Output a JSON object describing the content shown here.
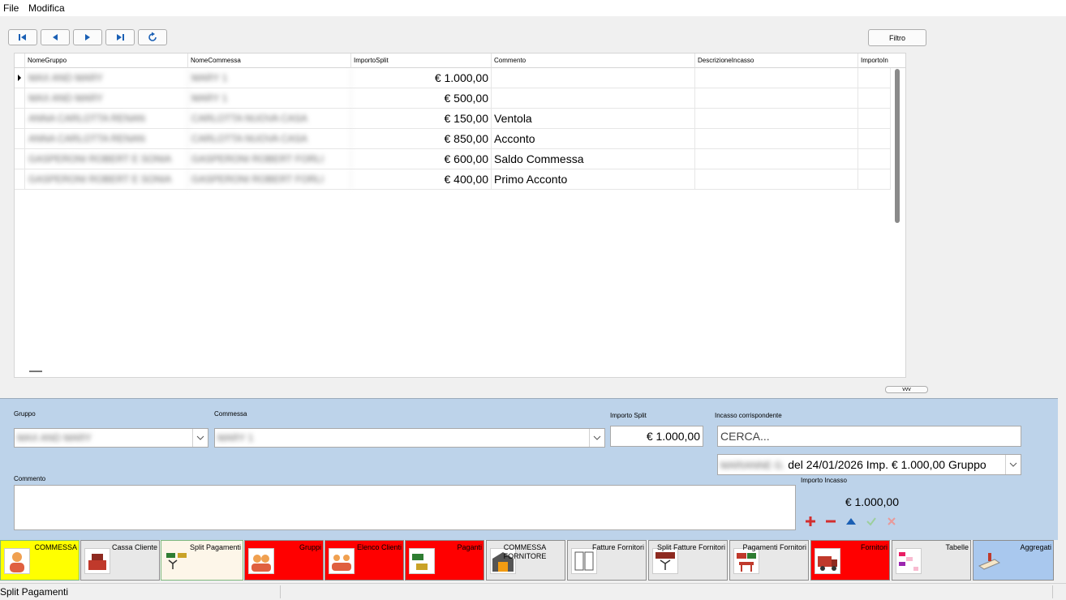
{
  "menu": {
    "file": "File",
    "edit": "Modifica"
  },
  "toolbar": {
    "first_icon": "first-record-icon",
    "prev_icon": "previous-record-icon",
    "next_icon": "next-record-icon",
    "last_icon": "last-record-icon",
    "refresh_icon": "refresh-icon",
    "filter_label": "Filtro"
  },
  "grid": {
    "columns": [
      "NomeGruppo",
      "NomeCommessa",
      "ImportoSplit",
      "Commento",
      "DescrizioneIncasso",
      "ImportoIn"
    ],
    "rows": [
      {
        "gruppo": "MAX AND MARY",
        "commessa": "MARY 1",
        "importo": "€ 1.000,00",
        "commento": ""
      },
      {
        "gruppo": "MAX AND MARY",
        "commessa": "MARY 1",
        "importo": "€ 500,00",
        "commento": ""
      },
      {
        "gruppo": "ANNA CARLOTTA RENAN",
        "commessa": "CARLOTTA NUOVA CASA",
        "importo": "€ 150,00",
        "commento": "Ventola"
      },
      {
        "gruppo": "ANNA CARLOTTA RENAN",
        "commessa": "CARLOTTA NUOVA CASA",
        "importo": "€ 850,00",
        "commento": "Acconto"
      },
      {
        "gruppo": "GASPERONI ROBERT E SONIA",
        "commessa": "GASPERONI ROBERT FORLI",
        "importo": "€ 600,00",
        "commento": "Saldo Commessa"
      },
      {
        "gruppo": "GASPERONI ROBERT E SONIA",
        "commessa": "GASPERONI ROBERT FORLI",
        "importo": "€ 400,00",
        "commento": "Primo Acconto"
      }
    ],
    "current_row_icon": "current-row-indicator-icon",
    "small_button": "vvv"
  },
  "form": {
    "gruppo_label": "Gruppo",
    "gruppo_value": "MAX AND MARY",
    "commessa_label": "Commessa",
    "commessa_value": "MARY 1",
    "importo_split_label": "Importo Split",
    "importo_split_value": "€ 1.000,00",
    "incasso_label": "Incasso corrispondente",
    "cerca_placeholder": "CERCA...",
    "incasso_name": "MARIANNE G.",
    "incasso_value": "del 24/01/2026 Imp. € 1.000,00 Gruppo",
    "commento_label": "Commento",
    "commento_value": "",
    "importo_incasso_label": "Importo Incasso",
    "importo_incasso_value": "€ 1.000,00",
    "actions": {
      "add_icon": "plus-icon",
      "remove_icon": "minus-icon",
      "up_icon": "triangle-up-icon",
      "confirm_icon": "check-icon",
      "cancel_icon": "x-icon"
    }
  },
  "tabs": [
    {
      "label": "COMMESSA",
      "bg": "#ffff00",
      "icon": "person-icon"
    },
    {
      "label": "Cassa Cliente",
      "bg": "#e8e8e8",
      "icon": "cash-register-icon"
    },
    {
      "label": "Split Pagamenti",
      "bg": "#fdf6e9",
      "icon": "split-money-icon"
    },
    {
      "label": "Gruppi",
      "bg": "#ff0000",
      "icon": "group-icon"
    },
    {
      "label": "Elenco Clienti",
      "bg": "#ff0000",
      "icon": "clients-icon"
    },
    {
      "label": "Paganti",
      "bg": "#ff0000",
      "icon": "payers-icon"
    },
    {
      "label": "COMMESSA FORNITORE",
      "bg": "#e8e8e8",
      "icon": "warehouse-icon"
    },
    {
      "label": "Fatture Fornitori",
      "bg": "#e8e8e8",
      "icon": "invoice-icon"
    },
    {
      "label": "Split Fatture Fornitori",
      "bg": "#e8e8e8",
      "icon": "split-invoice-icon"
    },
    {
      "label": "Pagamenti Fornitori",
      "bg": "#e8e8e8",
      "icon": "supplier-payment-icon"
    },
    {
      "label": "Fornitori",
      "bg": "#ff0000",
      "icon": "truck-icon"
    },
    {
      "label": "Tabelle",
      "bg": "#e8e8e8",
      "icon": "table-icon"
    },
    {
      "label": "Aggregati",
      "bg": "#a9c8ee",
      "icon": "aggregate-icon"
    }
  ],
  "status": {
    "text": "Split Pagamenti"
  }
}
